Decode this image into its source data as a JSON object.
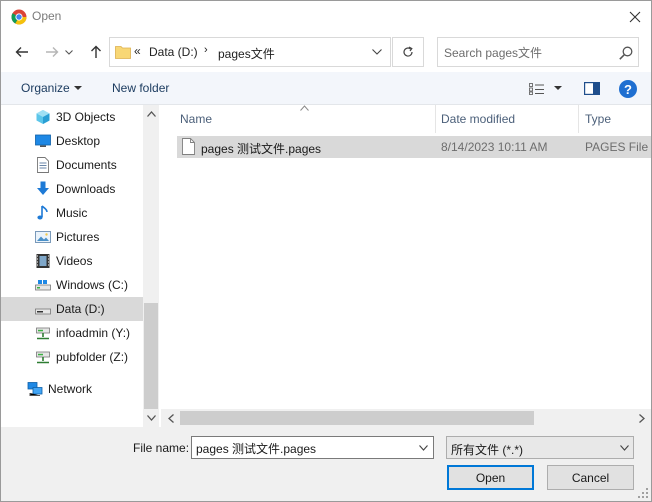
{
  "window": {
    "title": "Open",
    "app_icon": "chrome-icon",
    "close_icon": "close-icon"
  },
  "navbar": {
    "back_icon": "arrow-left-icon",
    "forward_icon": "arrow-right-icon",
    "recent_icon": "chevron-down-icon",
    "up_icon": "arrow-up-icon",
    "address": {
      "overflow": "«",
      "segments": [
        "Data (D:)",
        "pages文件"
      ],
      "separator": "›"
    },
    "refresh_icon": "refresh-icon",
    "search": {
      "placeholder": "Search pages文件",
      "icon": "search-icon"
    }
  },
  "toolbar": {
    "organize_label": "Organize",
    "new_folder_label": "New folder",
    "view_icon": "view-options-icon",
    "preview_icon": "preview-pane-icon",
    "help_label": "?"
  },
  "nav_pane": {
    "items": [
      {
        "label": "3D Objects",
        "icon": "3d-objects-icon",
        "selected": false
      },
      {
        "label": "Desktop",
        "icon": "desktop-icon",
        "selected": false
      },
      {
        "label": "Documents",
        "icon": "documents-icon",
        "selected": false
      },
      {
        "label": "Downloads",
        "icon": "downloads-icon",
        "selected": false
      },
      {
        "label": "Music",
        "icon": "music-icon",
        "selected": false
      },
      {
        "label": "Pictures",
        "icon": "pictures-icon",
        "selected": false
      },
      {
        "label": "Videos",
        "icon": "videos-icon",
        "selected": false
      },
      {
        "label": "Windows (C:)",
        "icon": "drive-icon",
        "selected": false
      },
      {
        "label": "Data (D:)",
        "icon": "drive-icon",
        "selected": true
      },
      {
        "label": "infoadmin (Y:)",
        "icon": "network-drive-icon",
        "selected": false
      },
      {
        "label": "pubfolder (Z:)",
        "icon": "network-drive-icon",
        "selected": false
      }
    ],
    "network": {
      "label": "Network",
      "icon": "network-icon"
    }
  },
  "file_list": {
    "columns": [
      "Name",
      "Date modified",
      "Type"
    ],
    "sort_column": "Name",
    "rows": [
      {
        "name": "pages 测试文件.pages",
        "date_modified": "8/14/2023 10:11 AM",
        "type": "PAGES File",
        "icon": "file-icon",
        "selected": true
      }
    ]
  },
  "bottom": {
    "file_name_label": "File name:",
    "file_name_value": "pages 测试文件.pages",
    "file_type_value": "所有文件 (*.*)",
    "open_label": "Open",
    "cancel_label": "Cancel"
  },
  "colors": {
    "accent": "#0078d7",
    "selection": "#d9d9d9",
    "toolbar_bg": "#f3f6fb",
    "help_blue": "#1f6fd1"
  }
}
